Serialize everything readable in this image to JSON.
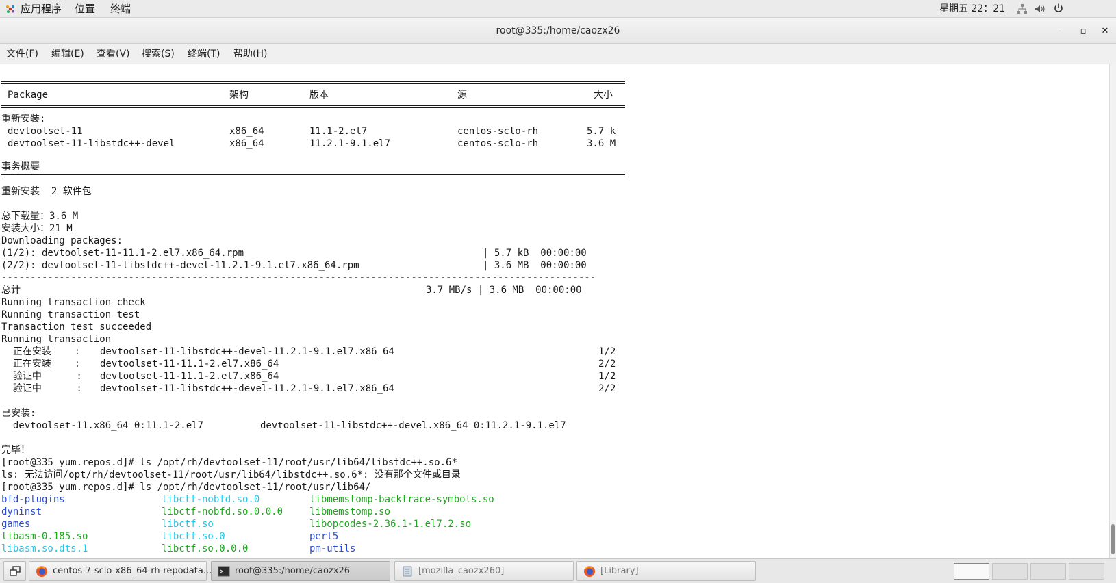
{
  "top_panel": {
    "applications": "应用程序",
    "places": "位置",
    "terminal": "终端",
    "clock": "星期五 22：21"
  },
  "window": {
    "title": "root@335:/home/caozx26",
    "minimize": "–",
    "maximize": "▫",
    "close": "✕"
  },
  "menubar": {
    "items": [
      "文件(F)",
      "编辑(E)",
      "查看(V)",
      "搜索(S)",
      "终端(T)",
      "帮助(H)"
    ]
  },
  "terminal": {
    "table_header": {
      "package": "Package",
      "arch": "架构",
      "version": "版本",
      "repo": "源",
      "size": "大小"
    },
    "reinstall_label": "重新安装:",
    "packages": [
      {
        "name": "devtoolset-11",
        "arch": "x86_64",
        "version": "11.1-2.el7",
        "repo": "centos-sclo-rh",
        "size": "5.7 k"
      },
      {
        "name": "devtoolset-11-libstdc++-devel",
        "arch": "x86_64",
        "version": "11.2.1-9.1.el7",
        "repo": "centos-sclo-rh",
        "size": "3.6 M"
      }
    ],
    "summary_label": "事务概要",
    "reinstall_count": "重新安装  2 软件包",
    "total_download": "总下载量：3.6 M",
    "install_size": "安装大小：21 M",
    "downloading": "Downloading packages:",
    "downloads": [
      {
        "file": "(1/2): devtoolset-11-11.1-2.el7.x86_64.rpm",
        "size": "| 5.7 kB  00:00:00"
      },
      {
        "file": "(2/2): devtoolset-11-libstdc++-devel-11.2.1-9.1.el7.x86_64.rpm",
        "size": "| 3.6 MB  00:00:00"
      }
    ],
    "dash_line": "-------------------------------------------------------------------------------------------------------",
    "total_label": "总计",
    "total_value": "3.7 MB/s | 3.6 MB  00:00:00",
    "check": "Running transaction check",
    "test": "Running transaction test",
    "succeeded": "Transaction test succeeded",
    "running": "Running transaction",
    "steps": [
      {
        "action": "  正在安装    :",
        "pkg": "devtoolset-11-libstdc++-devel-11.2.1-9.1.el7.x86_64",
        "count": "1/2"
      },
      {
        "action": "  正在安装    :",
        "pkg": "devtoolset-11-11.1-2.el7.x86_64",
        "count": "2/2"
      },
      {
        "action": "  验证中      :",
        "pkg": "devtoolset-11-11.1-2.el7.x86_64",
        "count": "1/2"
      },
      {
        "action": "  验证中      :",
        "pkg": "devtoolset-11-libstdc++-devel-11.2.1-9.1.el7.x86_64",
        "count": "2/2"
      }
    ],
    "installed_label": "已安装:",
    "installed_a": "  devtoolset-11.x86_64 0:11.1-2.el7",
    "installed_b": "devtoolset-11-libstdc++-devel.x86_64 0:11.2.1-9.1.el7",
    "done": "完毕！",
    "cmd1": "[root@335 yum.repos.d]# ls /opt/rh/devtoolset-11/root/usr/lib64/libstdc++.so.6*",
    "err1": "ls: 无法访问/opt/rh/devtoolset-11/root/usr/lib64/libstdc++.so.6*: 没有那个文件或目录",
    "cmd2": "[root@335 yum.repos.d]# ls /opt/rh/devtoolset-11/root/usr/lib64/",
    "listing": [
      [
        {
          "t": "bfd-plugins",
          "c": "#2a4bd7"
        },
        {
          "t": "libctf-nobfd.so.0",
          "c": "#22c6e8"
        },
        {
          "t": "libmemstomp-backtrace-symbols.so",
          "c": "#1ea81e"
        }
      ],
      [
        {
          "t": "dyninst",
          "c": "#2a4bd7"
        },
        {
          "t": "libctf-nobfd.so.0.0.0",
          "c": "#1ea81e"
        },
        {
          "t": "libmemstomp.so",
          "c": "#1ea81e"
        }
      ],
      [
        {
          "t": "games",
          "c": "#2a4bd7"
        },
        {
          "t": "libctf.so",
          "c": "#22c6e8"
        },
        {
          "t": "libopcodes-2.36.1-1.el7.2.so",
          "c": "#1ea81e"
        }
      ],
      [
        {
          "t": "libasm-0.185.so",
          "c": "#1ea81e"
        },
        {
          "t": "libctf.so.0",
          "c": "#22c6e8"
        },
        {
          "t": "perl5",
          "c": "#2a4bd7"
        }
      ],
      [
        {
          "t": "libasm.so.dts.1",
          "c": "#22c6e8"
        },
        {
          "t": "libctf.so.0.0.0",
          "c": "#1ea81e"
        },
        {
          "t": "pm-utils",
          "c": "#2a4bd7"
        }
      ]
    ]
  },
  "taskbar": {
    "tasks": [
      "centos-7-sclo-x86_64-rh-repodata...",
      "root@335:/home/caozx26",
      "[mozilla_caozx260]",
      "[Library]"
    ]
  },
  "colors": {
    "accent_blue": "#2a4bd7",
    "cyan": "#22c6e8",
    "green": "#1ea81e",
    "text": "#1a1a1a"
  }
}
